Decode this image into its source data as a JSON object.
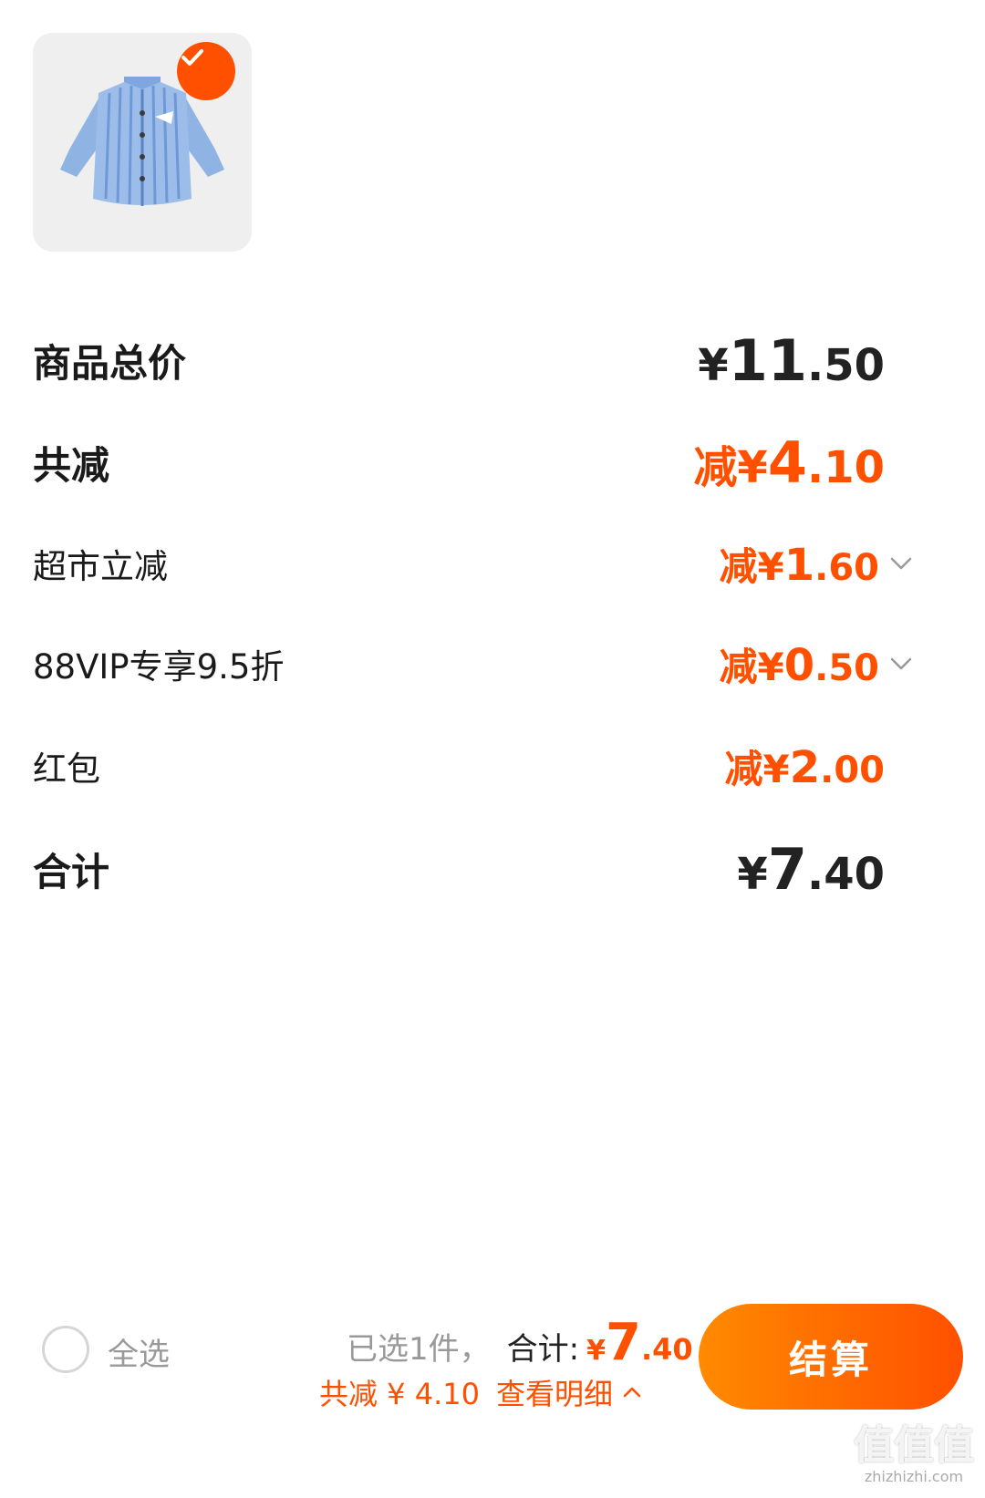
{
  "product": {
    "image_alt": "blue striped kids shirt",
    "selected": true
  },
  "price_rows": [
    {
      "label": "商品总价",
      "prefix": "",
      "yen": "¥",
      "int": "11",
      "dec": ".50",
      "style": "dark-big",
      "chevron": false
    },
    {
      "label": "共减",
      "prefix": "减",
      "yen": "¥",
      "int": "4",
      "dec": ".10",
      "style": "orange-big",
      "chevron": false
    },
    {
      "label": "超市立减",
      "prefix": "减",
      "yen": "¥",
      "int": "1",
      "dec": ".60",
      "style": "orange-mid",
      "chevron": true
    },
    {
      "label": "88VIP专享9.5折",
      "prefix": "减",
      "yen": "¥",
      "int": "0",
      "dec": ".50",
      "style": "orange-mid",
      "chevron": true
    },
    {
      "label": "红包",
      "prefix": "减",
      "yen": "¥",
      "int": "2",
      "dec": ".00",
      "style": "orange-mid",
      "chevron": false
    },
    {
      "label": "合计",
      "prefix": "",
      "yen": "¥",
      "int": "7",
      "dec": ".40",
      "style": "dark-big",
      "chevron": false
    }
  ],
  "bottom_bar": {
    "select_all": "全选",
    "selected_count": "已选1件，",
    "total_label": "合计:",
    "total_yen": "¥",
    "total_int": "7",
    "total_dec": ".40",
    "discount_text": "共减 ¥ 4.10",
    "detail_link": "查看明细",
    "checkout": "结算"
  },
  "watermark": {
    "logo": "值值值",
    "url": "zhizhizhi.com"
  },
  "colors": {
    "accent": "#ff5000",
    "accent_light": "#ff8a00",
    "text_dark": "#1a1a1a",
    "text_muted": "#999999"
  },
  "icons": {
    "check": "check-icon",
    "chevron_down": "chevron-down-icon",
    "chevron_up": "chevron-up-icon"
  }
}
